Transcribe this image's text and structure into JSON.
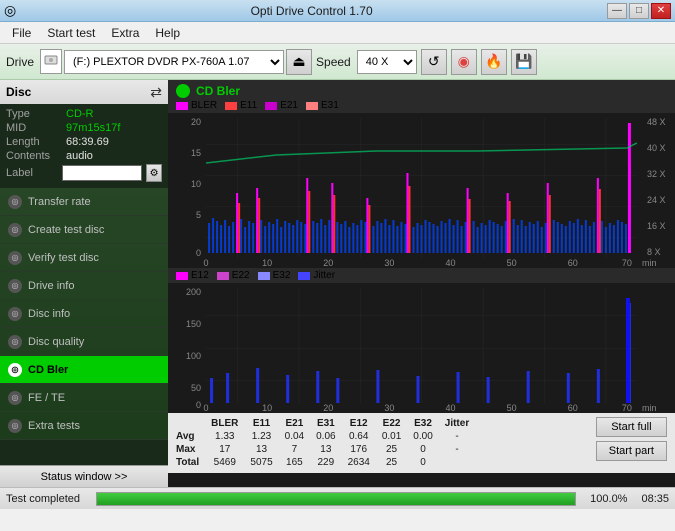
{
  "app": {
    "title": "Opti Drive Control 1.70",
    "icon": "◎"
  },
  "titlebar": {
    "minimize": "—",
    "maximize": "□",
    "close": "✕"
  },
  "menu": {
    "items": [
      "File",
      "Start test",
      "Extra",
      "Help"
    ]
  },
  "toolbar": {
    "drive_label": "Drive",
    "drive_value": "(F:)  PLEXTOR DVDR   PX-760A 1.07",
    "speed_label": "Speed",
    "speed_value": "40 X"
  },
  "sidebar": {
    "disc_title": "Disc",
    "info": {
      "type_label": "Type",
      "type_value": "CD-R",
      "mid_label": "MID",
      "mid_value": "97m15s17f",
      "length_label": "Length",
      "length_value": "68:39.69",
      "contents_label": "Contents",
      "contents_value": "audio",
      "label_label": "Label",
      "label_value": ""
    },
    "nav_items": [
      {
        "id": "transfer-rate",
        "label": "Transfer rate",
        "active": false
      },
      {
        "id": "create-test-disc",
        "label": "Create test disc",
        "active": false
      },
      {
        "id": "verify-test-disc",
        "label": "Verify test disc",
        "active": false
      },
      {
        "id": "drive-info",
        "label": "Drive info",
        "active": false
      },
      {
        "id": "disc-info",
        "label": "Disc info",
        "active": false
      },
      {
        "id": "disc-quality",
        "label": "Disc quality",
        "active": false
      },
      {
        "id": "cd-bler",
        "label": "CD Bler",
        "active": true
      },
      {
        "id": "fe-te",
        "label": "FE / TE",
        "active": false
      },
      {
        "id": "extra-tests",
        "label": "Extra tests",
        "active": false
      }
    ],
    "status_btn": "Status window >>"
  },
  "chart": {
    "title": "CD Bler",
    "legend1": [
      {
        "label": "BLER",
        "color": "#ff00ff"
      },
      {
        "label": "E11",
        "color": "#ff4040"
      },
      {
        "label": "E21",
        "color": "#cc00cc"
      },
      {
        "label": "E31",
        "color": "#ff8080"
      }
    ],
    "legend2": [
      {
        "label": "E12",
        "color": "#ff00ff"
      },
      {
        "label": "E22",
        "color": "#cc44cc"
      },
      {
        "label": "E32",
        "color": "#8888ff"
      },
      {
        "label": "Jitter",
        "color": "#4444ff"
      }
    ],
    "x_labels": [
      "0",
      "10",
      "20",
      "30",
      "40",
      "50",
      "60",
      "70"
    ],
    "x_unit": "min",
    "y_labels_1": [
      "20",
      "15",
      "10",
      "5",
      "0"
    ],
    "y_labels_2": [
      "200",
      "150",
      "100",
      "50",
      "0"
    ],
    "y_right_1": [
      "48 X",
      "40 X",
      "32 X",
      "24 X",
      "16 X",
      "8 X"
    ],
    "y_right_2": []
  },
  "stats": {
    "columns": [
      "",
      "BLER",
      "E11",
      "E21",
      "E31",
      "E12",
      "E22",
      "E32",
      "Jitter"
    ],
    "rows": [
      {
        "label": "Avg",
        "values": [
          "1.33",
          "1.23",
          "0.04",
          "0.06",
          "0.64",
          "0.01",
          "0.00",
          "-"
        ]
      },
      {
        "label": "Max",
        "values": [
          "17",
          "13",
          "7",
          "13",
          "176",
          "25",
          "0",
          "-"
        ]
      },
      {
        "label": "Total",
        "values": [
          "5469",
          "5075",
          "165",
          "229",
          "2634",
          "25",
          "0",
          ""
        ]
      }
    ],
    "btn_full": "Start full",
    "btn_part": "Start part"
  },
  "statusbar": {
    "status_text": "Test completed",
    "progress": 100.0,
    "progress_text": "100.0%",
    "time": "08:35"
  }
}
